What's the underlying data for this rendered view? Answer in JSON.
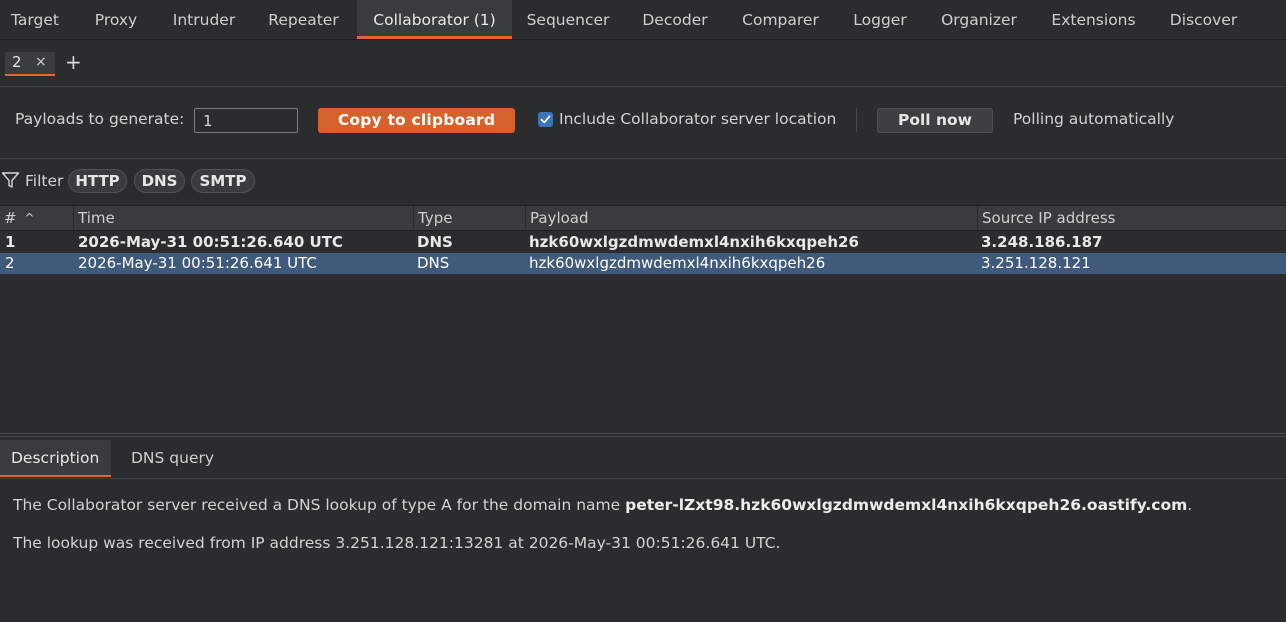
{
  "top_tabs": [
    {
      "label": "Target"
    },
    {
      "label": "Proxy"
    },
    {
      "label": "Intruder"
    },
    {
      "label": "Repeater"
    },
    {
      "label": "Collaborator (1)",
      "active": true
    },
    {
      "label": "Sequencer"
    },
    {
      "label": "Decoder"
    },
    {
      "label": "Comparer"
    },
    {
      "label": "Logger"
    },
    {
      "label": "Organizer"
    },
    {
      "label": "Extensions"
    },
    {
      "label": "Discover"
    }
  ],
  "sub_tabs": {
    "tab_label": "2",
    "close_glyph": "×",
    "add_glyph": "+"
  },
  "controls": {
    "payloads_label": "Payloads to generate:",
    "payloads_value": "1",
    "copy_button": "Copy to clipboard",
    "include_location_label": "Include Collaborator server location",
    "include_location_checked": true,
    "poll_button": "Poll now",
    "polling_status": "Polling automatically"
  },
  "filter": {
    "label": "Filter",
    "pills": [
      "HTTP",
      "DNS",
      "SMTP"
    ]
  },
  "table": {
    "columns": [
      "#",
      "Time",
      "Type",
      "Payload",
      "Source IP address"
    ],
    "sort_indicator": "^",
    "rows": [
      {
        "num": "1",
        "time": "2026-May-31 00:51:26.640 UTC",
        "type": "DNS",
        "payload": "hzk60wxlgzdmwdemxl4nxih6kxqpeh26",
        "source_ip": "3.248.186.187",
        "unread": true,
        "selected": false
      },
      {
        "num": "2",
        "time": "2026-May-31 00:51:26.641 UTC",
        "type": "DNS",
        "payload": "hzk60wxlgzdmwdemxl4nxih6kxqpeh26",
        "source_ip": "3.251.128.121",
        "unread": false,
        "selected": true
      }
    ]
  },
  "detail_tabs": [
    {
      "label": "Description",
      "active": true
    },
    {
      "label": "DNS query"
    }
  ],
  "description": {
    "line1_prefix": "The Collaborator server received a DNS lookup of type A for the domain name ",
    "line1_domain": "peter-lZxt98.hzk60wxlgzdmwdemxl4nxih6kxqpeh26.oastify.com",
    "line1_suffix": ".",
    "line2": "The lookup was received from IP address 3.251.128.121:13281 at 2026-May-31 00:51:26.641 UTC."
  },
  "colors": {
    "accent": "#e0672f",
    "background": "#2b2c2e",
    "selection": "#3f5a7a",
    "checkbox": "#3d74b8"
  }
}
